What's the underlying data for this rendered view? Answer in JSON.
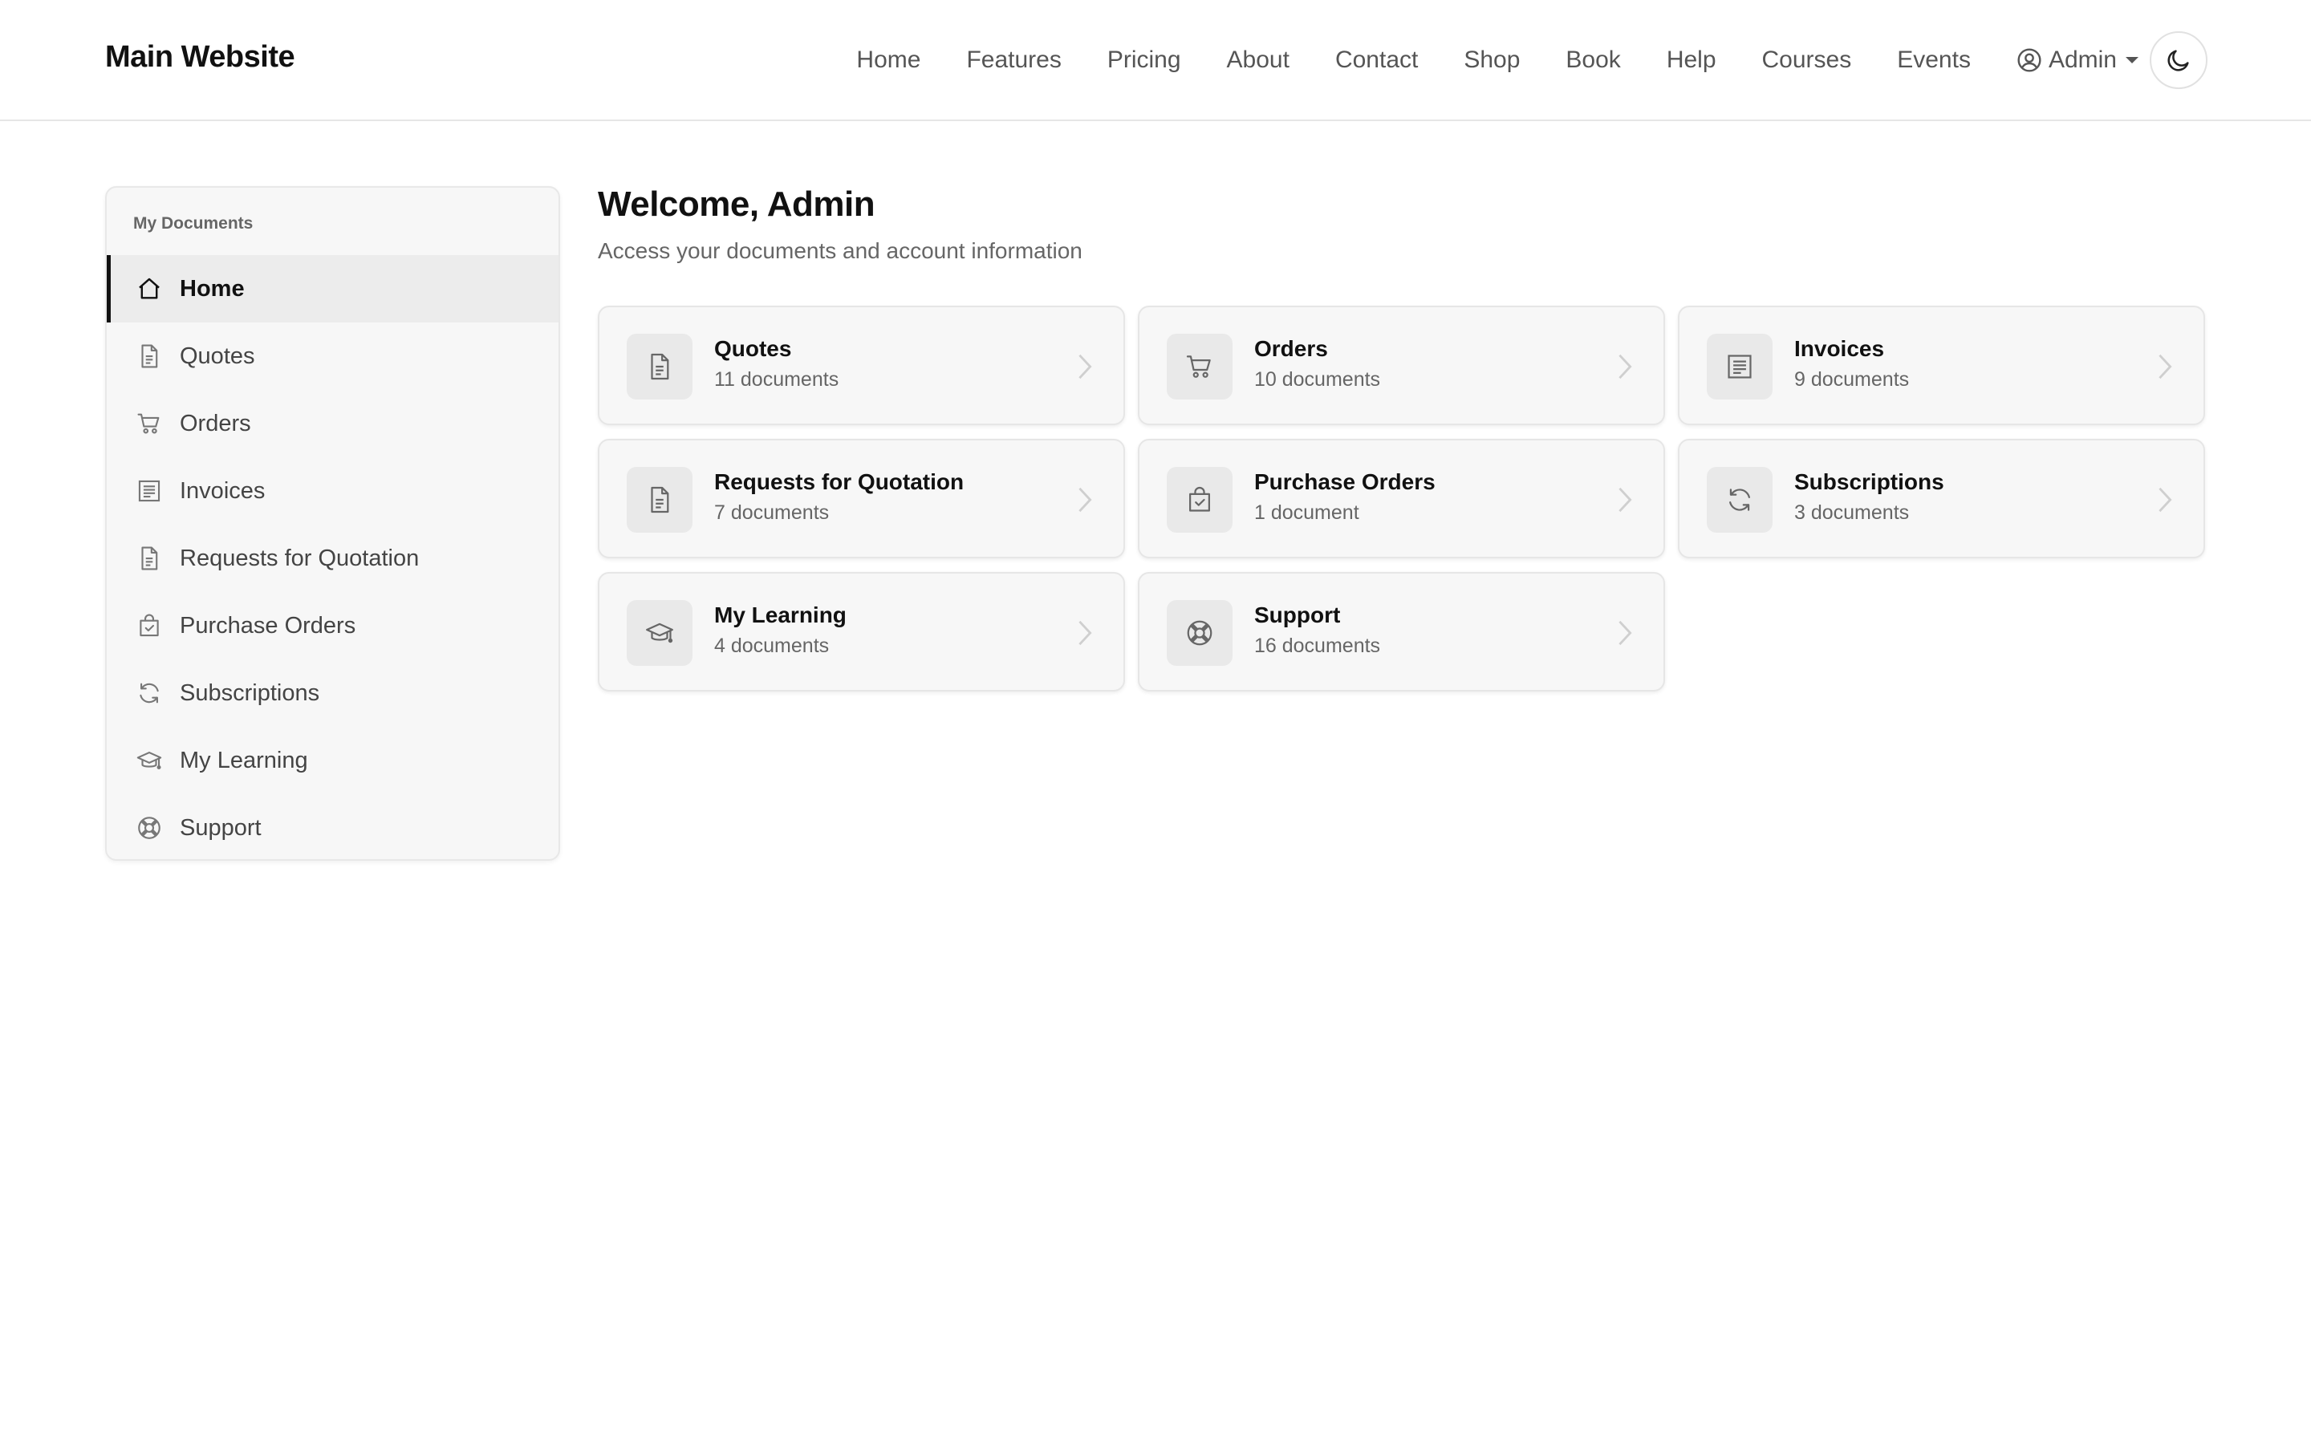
{
  "header": {
    "brand": "Main Website",
    "nav": [
      "Home",
      "Features",
      "Pricing",
      "About",
      "Contact",
      "Shop",
      "Book",
      "Help",
      "Courses",
      "Events"
    ],
    "user_label": "Admin",
    "theme_toggle_icon": "moon-icon"
  },
  "sidebar": {
    "heading": "My Documents",
    "items": [
      {
        "label": "Home",
        "icon": "home-icon",
        "active": true
      },
      {
        "label": "Quotes",
        "icon": "document-icon"
      },
      {
        "label": "Orders",
        "icon": "cart-icon"
      },
      {
        "label": "Invoices",
        "icon": "invoice-icon"
      },
      {
        "label": "Requests for Quotation",
        "icon": "document-icon"
      },
      {
        "label": "Purchase Orders",
        "icon": "bag-check-icon"
      },
      {
        "label": "Subscriptions",
        "icon": "refresh-icon"
      },
      {
        "label": "My Learning",
        "icon": "graduation-cap-icon"
      },
      {
        "label": "Support",
        "icon": "lifebuoy-icon"
      }
    ]
  },
  "main": {
    "title": "Welcome, Admin",
    "subtitle": "Access your documents and account information",
    "cards": [
      {
        "title": "Quotes",
        "count": "11 documents",
        "icon": "document-icon"
      },
      {
        "title": "Orders",
        "count": "10 documents",
        "icon": "cart-icon"
      },
      {
        "title": "Invoices",
        "count": "9 documents",
        "icon": "invoice-icon"
      },
      {
        "title": "Requests for Quotation",
        "count": "7 documents",
        "icon": "document-icon"
      },
      {
        "title": "Purchase Orders",
        "count": "1 document",
        "icon": "bag-check-icon"
      },
      {
        "title": "Subscriptions",
        "count": "3 documents",
        "icon": "refresh-icon"
      },
      {
        "title": "My Learning",
        "count": "4 documents",
        "icon": "graduation-cap-icon"
      },
      {
        "title": "Support",
        "count": "16 documents",
        "icon": "lifebuoy-icon"
      }
    ]
  },
  "colors": {
    "text_primary": "#111111",
    "text_muted": "#666666",
    "panel_bg": "#f7f7f7",
    "border": "#e6e6e6",
    "active_bg": "#ececec"
  }
}
